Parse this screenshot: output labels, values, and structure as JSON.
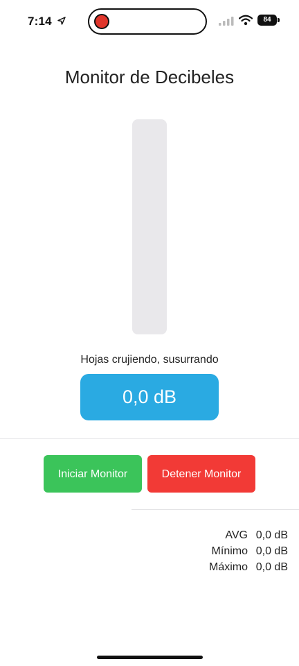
{
  "status_bar": {
    "time": "7:14",
    "battery": "84",
    "recording_color": "#e0352b"
  },
  "title": "Monitor de Decibeles",
  "meter": {
    "level": 0,
    "fill_color": "#2aa8e0",
    "track_color": "#e9e8eb"
  },
  "description": "Hojas crujiendo, susurrando",
  "reading": {
    "value": "0,0 dB",
    "color": "#2aaae2"
  },
  "buttons": {
    "start": {
      "label": "Iniciar Monitor",
      "color": "#3bc45a"
    },
    "stop": {
      "label": "Detener Monitor",
      "color": "#f23a36"
    }
  },
  "stats": [
    {
      "label": "AVG",
      "value": "0,0 dB"
    },
    {
      "label": "Mínimo",
      "value": "0,0 dB"
    },
    {
      "label": "Máximo",
      "value": "0,0 dB"
    }
  ],
  "icons": {
    "location": "location-arrow-icon",
    "signal": "cellular-signal-icon",
    "wifi": "wifi-icon",
    "battery": "battery-icon",
    "recording": "recording-indicator-icon"
  }
}
